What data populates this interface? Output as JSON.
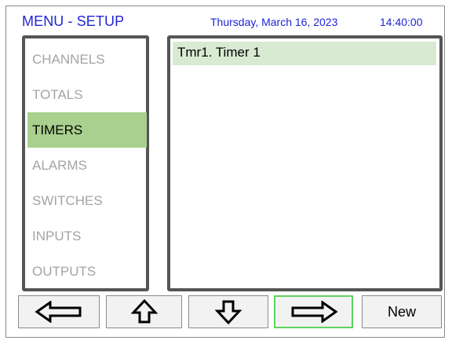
{
  "header": {
    "title": "MENU - SETUP",
    "date": "Thursday, March 16, 2023",
    "time": "14:40:00"
  },
  "sidebar": {
    "items": [
      {
        "label": "CHANNELS",
        "active": false
      },
      {
        "label": "TOTALS",
        "active": false
      },
      {
        "label": "TIMERS",
        "active": true
      },
      {
        "label": "ALARMS",
        "active": false
      },
      {
        "label": "SWITCHES",
        "active": false
      },
      {
        "label": "INPUTS",
        "active": false
      },
      {
        "label": "OUTPUTS",
        "active": false
      }
    ]
  },
  "main": {
    "rows": [
      "Tmr1. Timer 1"
    ]
  },
  "toolbar": {
    "buttons": [
      {
        "icon": "arrow-left-icon"
      },
      {
        "icon": "arrow-up-icon"
      },
      {
        "icon": "arrow-down-icon"
      },
      {
        "icon": "arrow-right-icon",
        "selected": true
      },
      {
        "label": "New"
      }
    ]
  },
  "colors": {
    "title_text": "#1f25d6",
    "active_item": "#a9d08e",
    "list_row": "#d9ead3",
    "selected_button_border": "#5fd35f",
    "panel_border": "#555555"
  }
}
